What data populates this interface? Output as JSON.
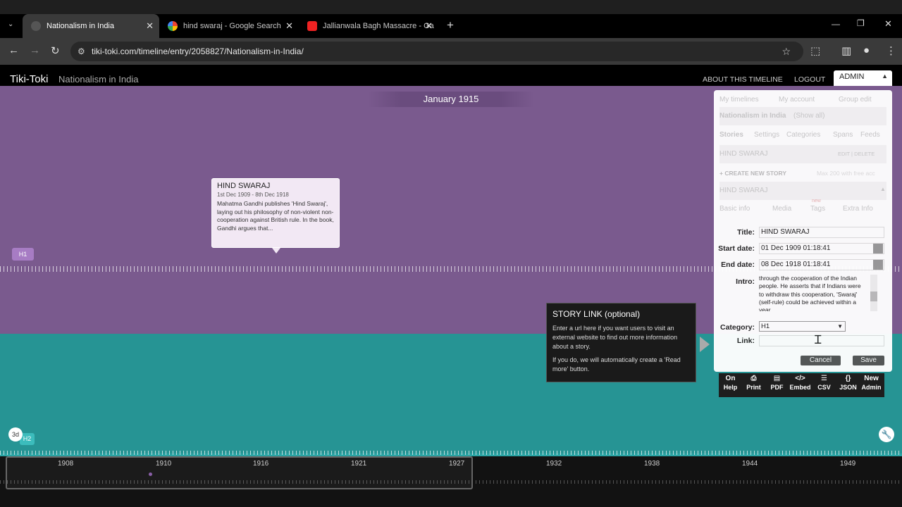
{
  "browser": {
    "tabs": [
      {
        "title": "Nationalism in India",
        "active": true,
        "icon": "globe-icon"
      },
      {
        "title": "hind swaraj - Google Search",
        "active": false,
        "icon": "google-icon"
      },
      {
        "title": "Jallianwala Bagh Massacre - Ga",
        "active": false,
        "icon": "youtube-icon"
      }
    ],
    "new_tab": "+",
    "url": "tiki-toki.com/timeline/entry/2058827/Nationalism-in-India/"
  },
  "app": {
    "brand": "Tiki-Toki",
    "timeline_title": "Nationalism in India",
    "top_links": {
      "about": "ABOUT THIS TIMELINE",
      "logout": "LOGOUT",
      "admin": "ADMIN"
    },
    "current_date": "January 1915",
    "category_label": "H1",
    "view_3d": "3d",
    "category_label2": "H2"
  },
  "story": {
    "title": "HIND SWARAJ",
    "dates": "1st Dec 1909 - 8th Dec 1918",
    "text": "Mahatma Gandhi publishes 'Hind Swaraj', laying out his philosophy of non-violent non-cooperation against British rule. In the book, Gandhi argues that..."
  },
  "admin": {
    "nav": {
      "my_timelines": "My timelines",
      "my_account": "My account",
      "group_edit": "Group edit"
    },
    "timeline_row": {
      "name": "Nationalism in India",
      "show_all": "(Show all)"
    },
    "subnav": [
      "Stories",
      "Settings",
      "Categories",
      "Spans",
      "Feeds"
    ],
    "list_item": {
      "title": "HIND SWARAJ",
      "actions": "EDIT | DELETE"
    },
    "create": {
      "label": "+ CREATE NEW STORY",
      "note": "Max 200 with free acc"
    },
    "editing": "HIND SWARAJ",
    "edit_tabs": [
      "Basic info",
      "Media",
      "Tags",
      "Extra Info"
    ],
    "new_badge": "new",
    "form": {
      "title_label": "Title:",
      "title_value": "HIND SWARAJ",
      "start_label": "Start date:",
      "start_value": "01 Dec 1909 01:18:41",
      "end_label": "End date:",
      "end_value": "08 Dec 1918 01:18:41",
      "intro_label": "Intro:",
      "intro_value": "through the cooperation of the Indian people. He asserts that if Indians were to withdraw this cooperation, 'Swaraj' (self-rule) could be achieved within a year.",
      "category_label": "Category:",
      "category_value": "H1",
      "link_label": "Link:",
      "link_value": ""
    },
    "cancel": "Cancel",
    "save": "Save"
  },
  "tooltip": {
    "title": "STORY LINK (optional)",
    "p1": "Enter a url here if you want users to visit an external website to find out more information about a story.",
    "p2": "If you do, we will automatically create a 'Read more' button."
  },
  "tools": [
    {
      "icon": "On",
      "label": "Help"
    },
    {
      "icon": "⎙",
      "label": "Print"
    },
    {
      "icon": "▤",
      "label": "PDF"
    },
    {
      "icon": "</>",
      "label": "Embed"
    },
    {
      "icon": "☰",
      "label": "CSV"
    },
    {
      "icon": "{}",
      "label": "JSON"
    },
    {
      "icon": "New",
      "label": "Admin"
    }
  ],
  "years": [
    "1908",
    "1910",
    "1916",
    "1921",
    "1927",
    "1932",
    "1938",
    "1944",
    "1949"
  ]
}
